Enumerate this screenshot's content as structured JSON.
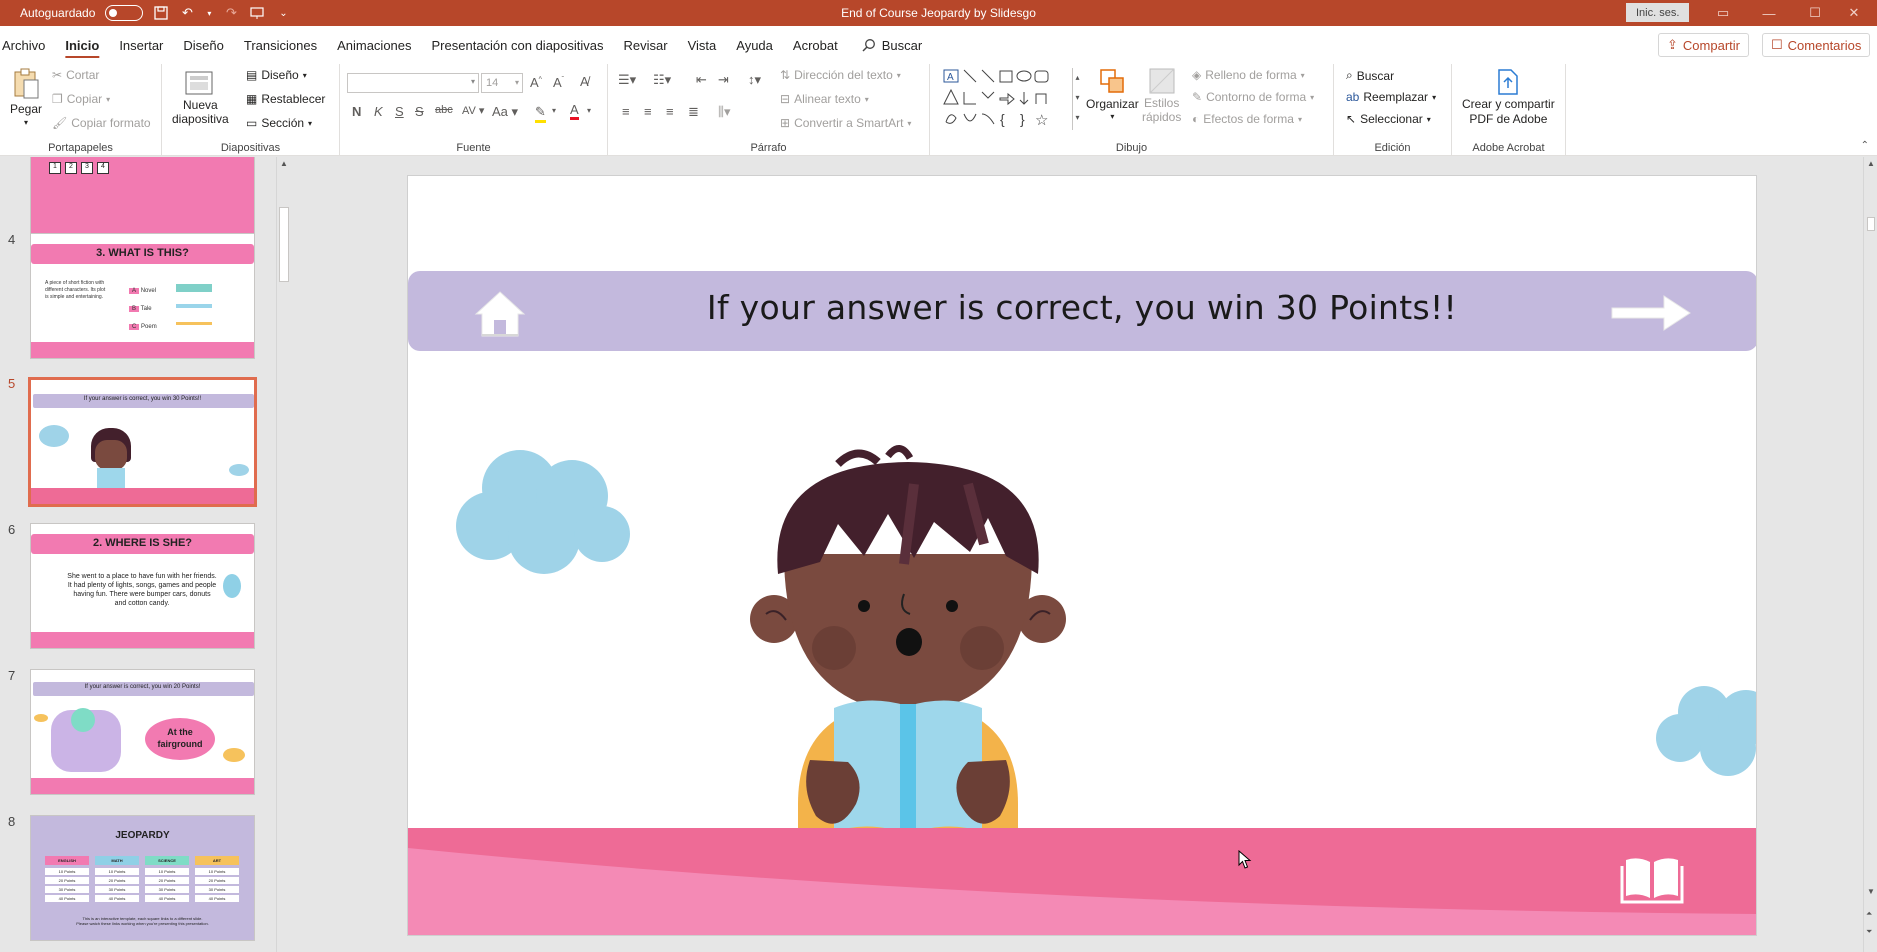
{
  "titlebar": {
    "autosave_label": "Autoguardado",
    "document_title": "End of Course Jeopardy by Slidesgo",
    "signin_label": "Inic. ses."
  },
  "tabs": [
    "Archivo",
    "Inicio",
    "Insertar",
    "Diseño",
    "Transiciones",
    "Animaciones",
    "Presentación con diapositivas",
    "Revisar",
    "Vista",
    "Ayuda",
    "Acrobat"
  ],
  "active_tab": "Inicio",
  "search_label": "Buscar",
  "share_label": "Compartir",
  "comments_label": "Comentarios",
  "ribbon": {
    "clipboard": {
      "paste": "Pegar",
      "cut": "Cortar",
      "copy": "Copiar",
      "format_painter": "Copiar formato",
      "label": "Portapapeles"
    },
    "slides": {
      "new_slide_1": "Nueva",
      "new_slide_2": "diapositiva",
      "layout": "Diseño",
      "reset": "Restablecer",
      "section": "Sección",
      "label": "Diapositivas"
    },
    "font": {
      "font_name": "",
      "font_size": "14",
      "label": "Fuente"
    },
    "paragraph": {
      "text_direction": "Dirección del texto",
      "align_text": "Alinear texto",
      "smartart": "Convertir a SmartArt",
      "label": "Párrafo"
    },
    "drawing": {
      "arrange": "Organizar",
      "quick_styles_1": "Estilos",
      "quick_styles_2": "rápidos",
      "shape_fill": "Relleno de forma",
      "shape_outline": "Contorno de forma",
      "shape_effects": "Efectos de forma",
      "label": "Dibujo"
    },
    "editing": {
      "find": "Buscar",
      "replace": "Reemplazar",
      "select": "Seleccionar",
      "label": "Edición"
    },
    "acrobat": {
      "create_1": "Crear y compartir",
      "create_2": "PDF de Adobe",
      "label": "Adobe Acrobat"
    }
  },
  "thumbnails": {
    "numbers": [
      "4",
      "5",
      "6",
      "7",
      "8"
    ],
    "slide4": {
      "title": "3. WHAT IS THIS?",
      "options": [
        "Novel",
        "Tale",
        "Poem"
      ],
      "letters": [
        "A",
        "B",
        "C"
      ],
      "body": "A piece of short fiction with different characters. Its plot is simple and entertaining."
    },
    "slide5": {
      "title": "If your answer is correct, you win 30 Points!!"
    },
    "slide6": {
      "title": "2. WHERE IS SHE?",
      "body": "She went to a place to have fun with her friends. It had plenty of lights, songs, games and people having fun. There were bumper cars, donuts and cotton candy."
    },
    "slide7": {
      "title": "If your answer is correct, you win 20 Points!",
      "bubble_1": "At the",
      "bubble_2": "fairground"
    },
    "slide8": {
      "title": "JEOPARDY",
      "categories": [
        "ENGLISH",
        "MATH",
        "SCIENCE",
        "ART"
      ],
      "points": [
        "10 Points",
        "20 Points",
        "30 Points",
        "40 Points"
      ],
      "footer_1": "This is an interactive template, each square links to a different slide.",
      "footer_2": "Please watch these links working when you're presenting this presentation."
    }
  },
  "slide": {
    "banner_text": "If your answer is correct, you win 30 Points!!"
  },
  "colors": {
    "accent": "#b7472a",
    "banner": "#c3b9dd",
    "pink": "#ee6b96",
    "cloud": "#9fd3e8"
  }
}
